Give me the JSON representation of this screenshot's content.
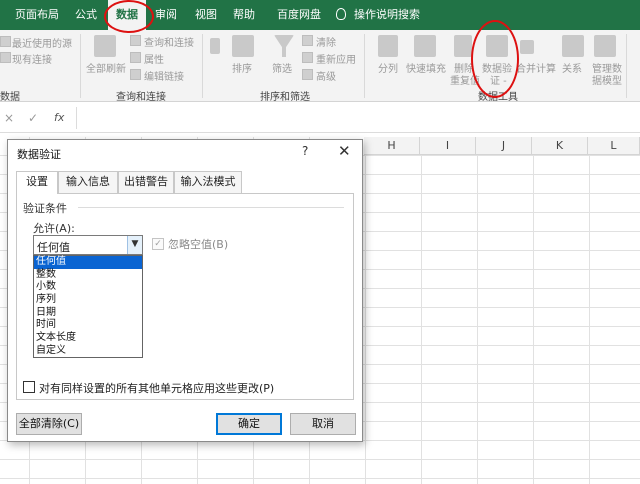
{
  "ribbon_tabs": [
    "页面布局",
    "公式",
    "数据",
    "审阅",
    "视图",
    "帮助",
    "百度网盘"
  ],
  "active_tab": "数据",
  "tell_me": "操作说明搜索",
  "ribbon": {
    "get_data": {
      "recent_sources": "最近使用的源",
      "existing_connections": "现有连接",
      "label": "数据"
    },
    "queries": {
      "refresh_all": "全部刷新",
      "queries_connections": "查询和连接",
      "properties": "属性",
      "edit_links": "编辑链接",
      "label": "查询和连接"
    },
    "sort_filter": {
      "sort": "排序",
      "filter": "筛选",
      "clear": "清除",
      "reapply": "重新应用",
      "advanced": "高级",
      "label": "排序和筛选"
    },
    "data_tools": {
      "text_to_columns": "分列",
      "flash_fill": "快速填充",
      "remove_dup_1": "删除",
      "remove_dup_2": "重复值",
      "validation_1": "数据验",
      "validation_2": "证 -",
      "consolidate": "合并计算",
      "relationships": "关系",
      "data_model_1": "管理数",
      "data_model_2": "据模型",
      "label": "数据工具"
    }
  },
  "formula_bar": {
    "cancel": "×",
    "enter": "✓",
    "fx": "fx"
  },
  "columns": [
    "H",
    "I",
    "J",
    "K",
    "L"
  ],
  "dialog": {
    "title": "数据验证",
    "help": "?",
    "close": "✕",
    "tabs": [
      "设置",
      "输入信息",
      "出错警告",
      "输入法模式"
    ],
    "section_title": "验证条件",
    "allow_label": "允许(A):",
    "allow_value": "任何值",
    "ignore_blank": "忽略空值(B)",
    "allow_options": [
      "任何值",
      "整数",
      "小数",
      "序列",
      "日期",
      "时间",
      "文本长度",
      "自定义"
    ],
    "apply_all": "对有同样设置的所有其他单元格应用这些更改(P)",
    "clear_all": "全部清除(C)",
    "ok": "确定",
    "cancel": "取消"
  }
}
